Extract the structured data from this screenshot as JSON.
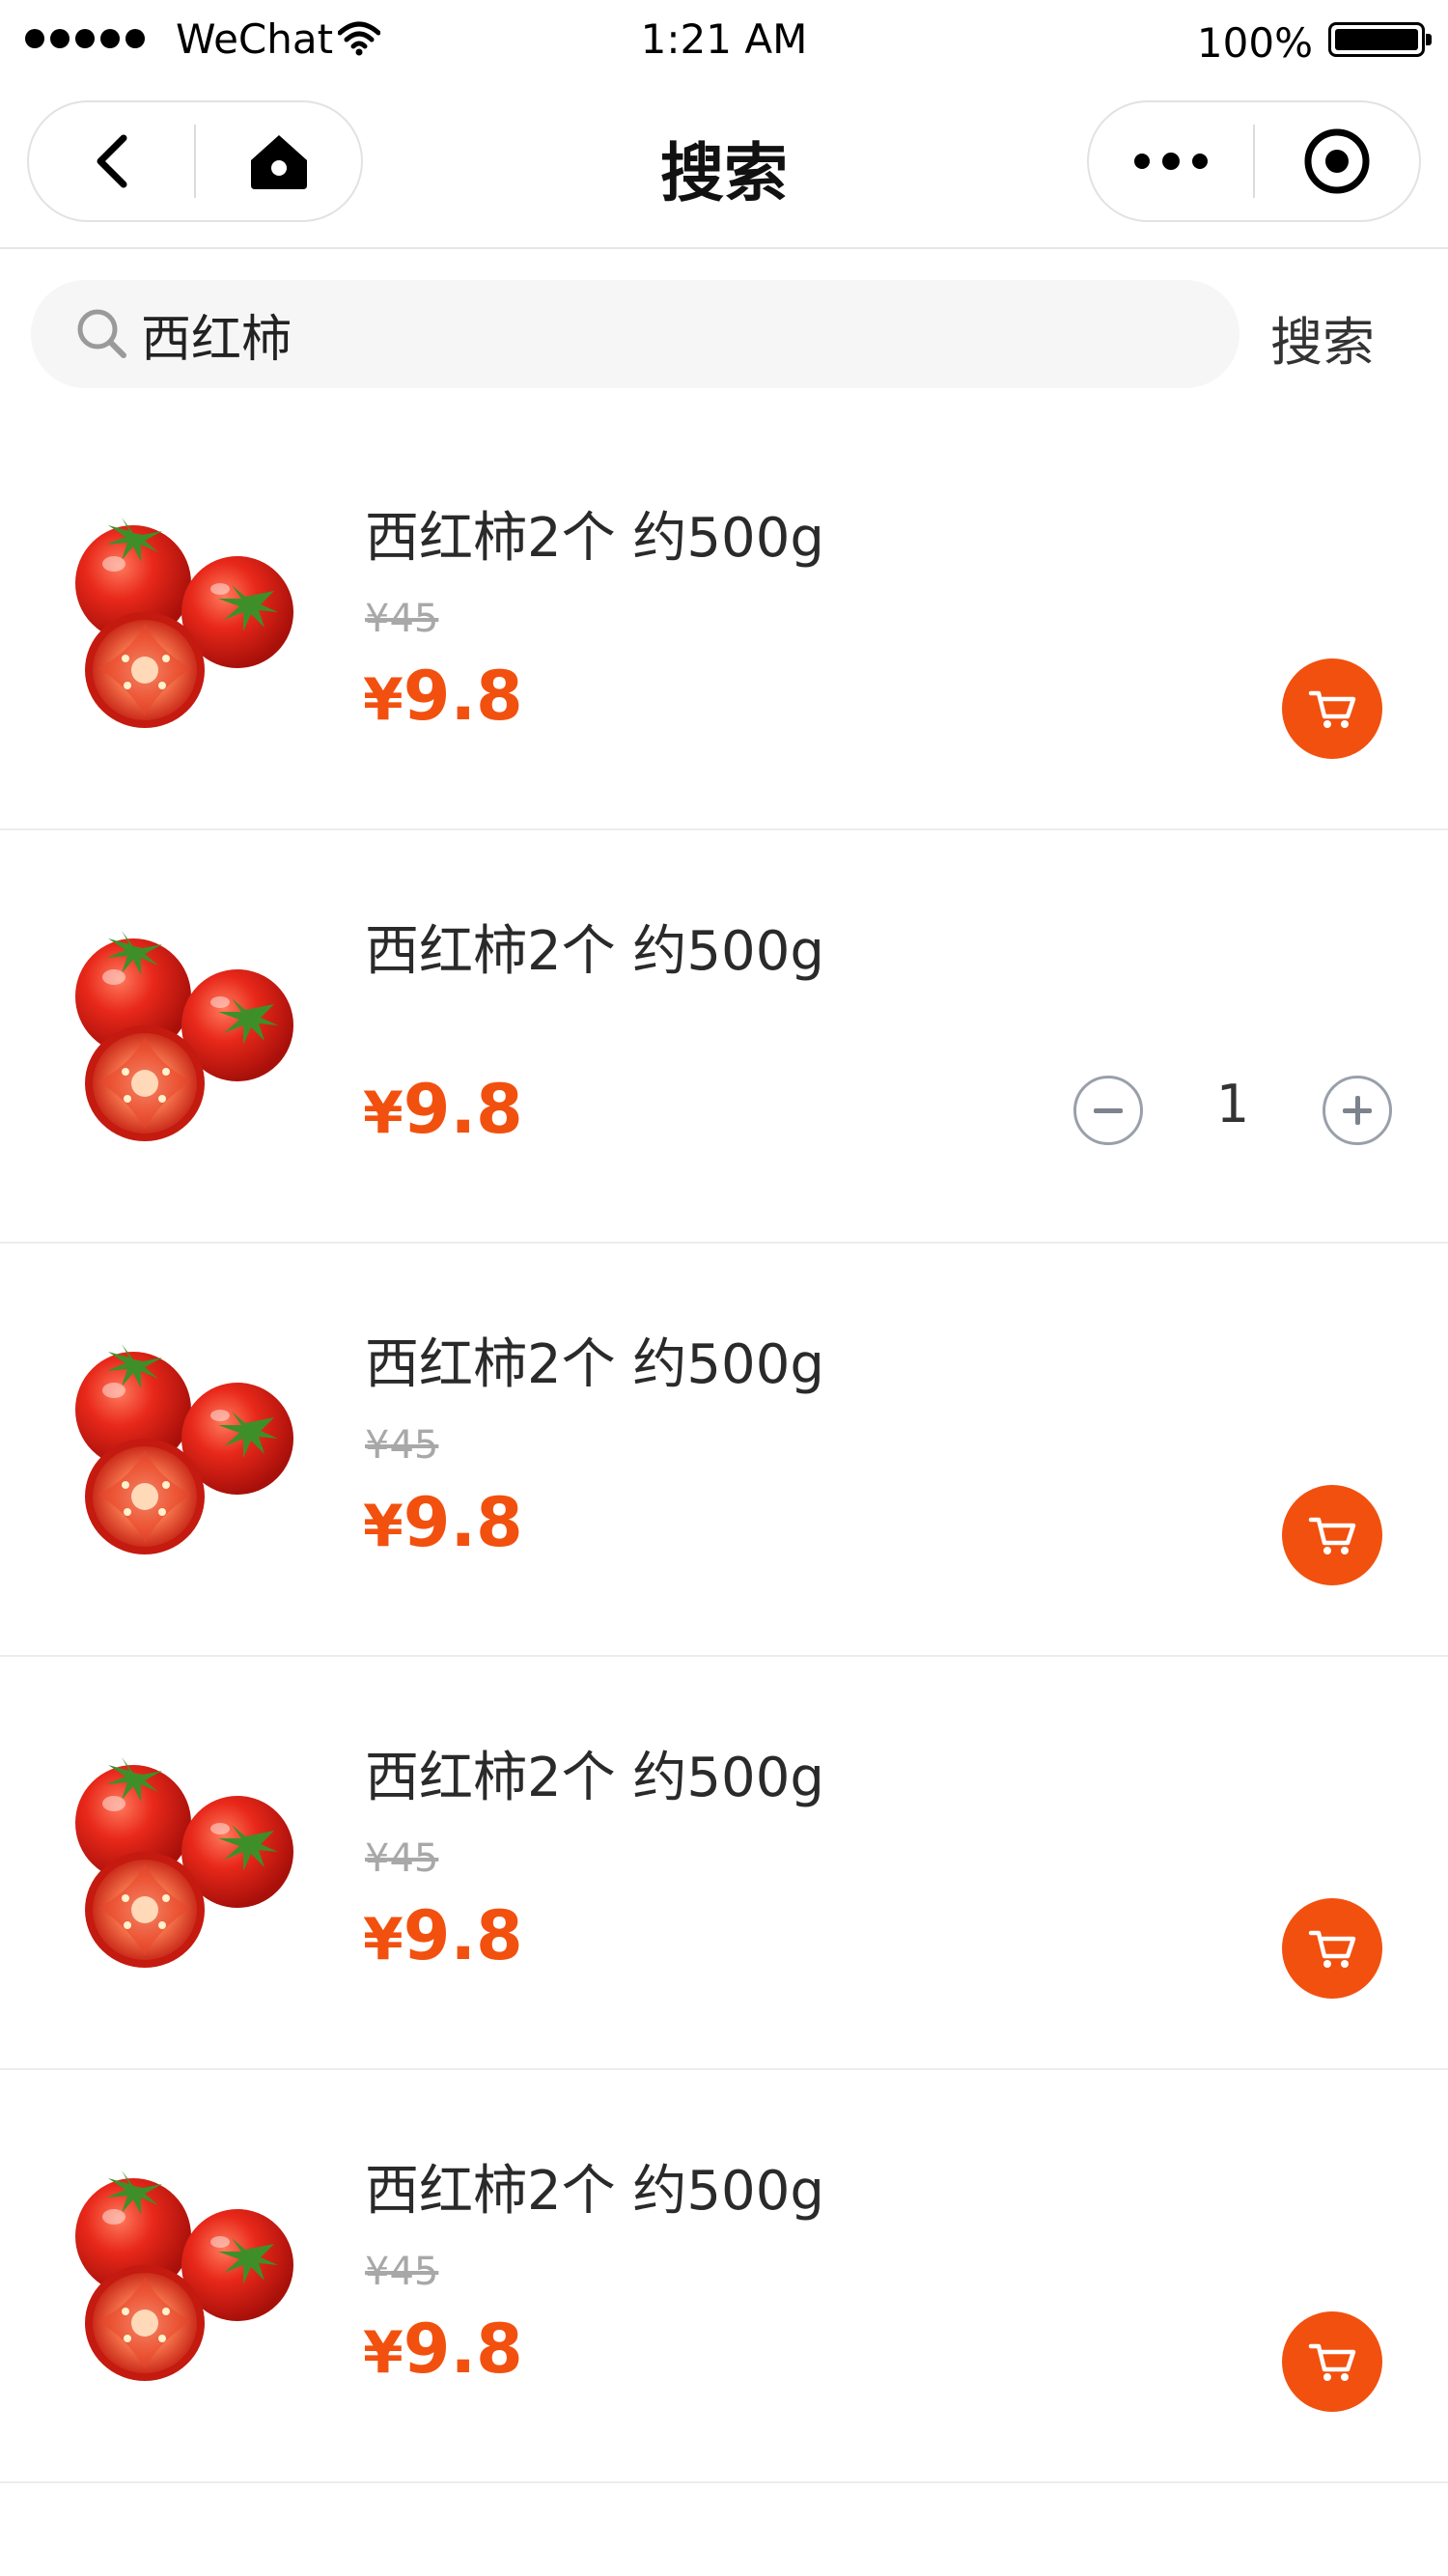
{
  "status_bar": {
    "carrier": "WeChat",
    "time": "1:21 AM",
    "battery": "100%"
  },
  "nav": {
    "title": "搜索"
  },
  "search": {
    "value": "西红柿",
    "button_label": "搜索"
  },
  "colors": {
    "accent": "#f2500f",
    "original_price": "#a8a8a8",
    "text": "#2a2a2a"
  },
  "products": [
    {
      "name": "西红柿2个 约500g",
      "original_price": "¥45",
      "currency": "¥",
      "price": "9.8",
      "action": "cart-icon"
    },
    {
      "name": "西红柿2个 约500g",
      "currency": "¥",
      "price": "9.8",
      "quantity": "1",
      "action": "stepper"
    },
    {
      "name": "西红柿2个 约500g",
      "original_price": "¥45",
      "currency": "¥",
      "price": "9.8",
      "action": "cart-icon"
    },
    {
      "name": "西红柿2个 约500g",
      "original_price": "¥45",
      "currency": "¥",
      "price": "9.8",
      "action": "cart-icon"
    },
    {
      "name": "西红柿2个 约500g",
      "original_price": "¥45",
      "currency": "¥",
      "price": "9.8",
      "action": "cart-icon"
    }
  ]
}
